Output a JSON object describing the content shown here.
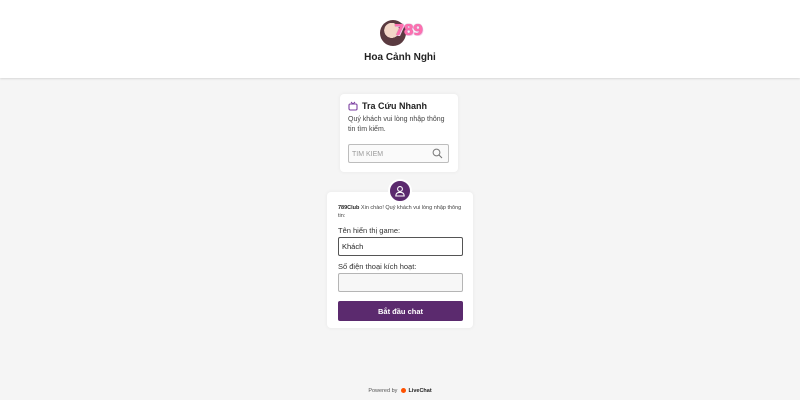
{
  "header": {
    "logo_text": "789",
    "brand_name": "Hoa Cảnh Nghi"
  },
  "quick_search": {
    "title": "Tra Cứu Nhanh",
    "description": "Quý khách vui lòng nhập thông tin tìm kiếm.",
    "placeholder": "TÌM KIẾM",
    "icon": "search-icon"
  },
  "chat_form": {
    "avatar_icon": "user-icon",
    "greeting_brand": "789Club",
    "greeting_text": " Xin chào! Quý khách vui lòng nhập thông tin:",
    "name_label": "Tên hiển thị game:",
    "name_value": "Khách",
    "phone_label": "Số điện thoại kích hoạt:",
    "phone_value": "",
    "start_label": "Bắt đầu chat"
  },
  "footer": {
    "powered_by": "Powered by",
    "provider": "LiveChat"
  },
  "colors": {
    "accent": "#5b2a6e",
    "background": "#f5f5f5",
    "card": "#ffffff",
    "livechat_orange": "#ff5100"
  }
}
